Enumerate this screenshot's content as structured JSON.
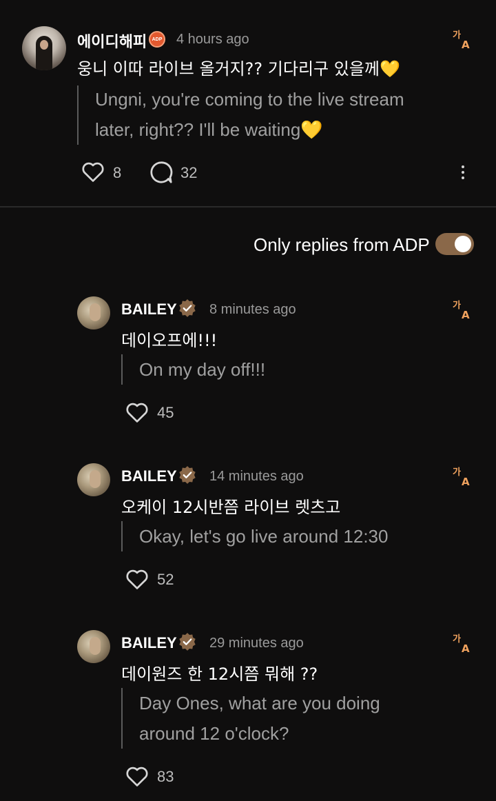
{
  "post": {
    "username": "에이디해피",
    "badge_text": "ADP",
    "time": "4 hours ago",
    "text": "웅니 이따 라이브 올거지?? 기다리구 있을께💛",
    "translation_line1": "Ungni, you're coming to the live stream",
    "translation_line2": "later, right?? I'll be waiting💛",
    "likes": "8",
    "comments": "32"
  },
  "filter": {
    "label": "Only replies from ADP",
    "enabled": true
  },
  "replies": [
    {
      "username": "BAILEY",
      "time": "8 minutes ago",
      "text": "데이오프에!!!",
      "translation_line1": "On my day off!!!",
      "translation_line2": "",
      "likes": "45"
    },
    {
      "username": "BAILEY",
      "time": "14 minutes ago",
      "text": "오케이 12시반쯤 라이브 렛츠고",
      "translation_line1": "Okay, let's go live around 12:30",
      "translation_line2": "",
      "likes": "52"
    },
    {
      "username": "BAILEY",
      "time": "29 minutes ago",
      "text": "데이원즈 한 12시쯤 뭐해 ??",
      "translation_line1": "Day Ones, what are you doing",
      "translation_line2": "around 12 o'clock?",
      "likes": "83"
    }
  ],
  "colors": {
    "background": "#0f0e0e",
    "accent_orange": "#f0a25e",
    "toggle_on": "#8a6849",
    "verified": "#8a6849",
    "badge": "#e3592f"
  },
  "icons": {
    "translate": "translate-icon",
    "heart": "heart-icon",
    "comment": "comment-icon",
    "more": "more-vertical-icon",
    "verified": "verified-icon"
  }
}
